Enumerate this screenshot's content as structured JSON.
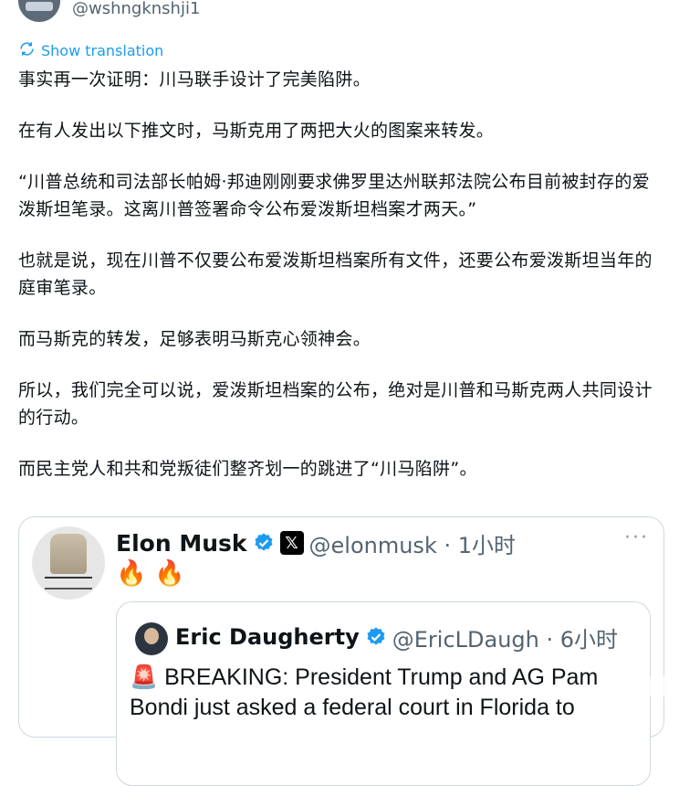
{
  "header": {
    "handle": "@wshngknshji1",
    "translate_label": "Show translation"
  },
  "post": {
    "paragraphs": [
      "事实再一次证明：川马联手设计了完美陷阱。",
      "在有人发出以下推文时，马斯克用了两把大火的图案来转发。",
      "“川普总统和司法部长帕姆·邦迪刚刚要求佛罗里达州联邦法院公布目前被封存的爱泼斯坦笔录。这离川普签署命令公布爱泼斯坦档案才两天。”",
      "也就是说，现在川普不仅要公布爱泼斯坦档案所有文件，还要公布爱泼斯坦当年的庭审笔录。",
      "而马斯克的转发，足够表明马斯克心领神会。",
      "所以，我们完全可以说，爱泼斯坦档案的公布，绝对是川普和马斯克两人共同设计的行动。",
      "而民主党人和共和党叛徒们整齐划一的跳进了“川马陷阱”。"
    ]
  },
  "quote": {
    "name": "Elon Musk",
    "x_badge": "𝕏",
    "handle_time": "@elonmusk · 1小时",
    "more": "···",
    "content": "🔥 🔥",
    "inner": {
      "name": "Eric Daugherty",
      "handle_time": "@EricLDaugh · 6小时",
      "siren": "🚨",
      "text": "BREAKING: President Trump and AG Pam Bondi just asked a federal court in Florida to"
    }
  },
  "colors": {
    "link_blue": "#1d9bf0",
    "muted_text": "#536471",
    "border": "#cfd9de"
  },
  "icons": [
    "translate-icon",
    "verified-badge-icon",
    "x-badge-icon",
    "more-icon",
    "siren-icon"
  ]
}
